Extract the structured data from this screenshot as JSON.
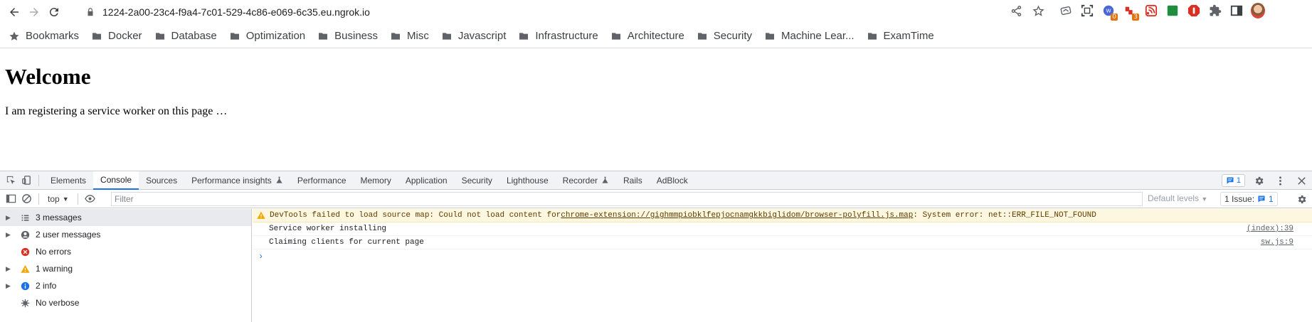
{
  "browser": {
    "url": "1224-2a00-23c4-f9a4-7c01-529-4c86-e069-6c35.eu.ngrok.io",
    "extensions": [
      {
        "icon": "wappalyzer-icon",
        "badge": "0"
      },
      {
        "icon": "ublock-icon",
        "badge": "3"
      }
    ]
  },
  "bookmarks": {
    "root_label": "Bookmarks",
    "folders": [
      "Docker",
      "Database",
      "Optimization",
      "Business",
      "Misc",
      "Javascript",
      "Infrastructure",
      "Architecture",
      "Security",
      "Machine Lear...",
      "ExamTime"
    ]
  },
  "page": {
    "heading": "Welcome",
    "paragraph": "I am registering a service worker on this page …"
  },
  "devtools": {
    "tabs": [
      "Elements",
      "Console",
      "Sources",
      "Performance insights",
      "Performance",
      "Memory",
      "Application",
      "Security",
      "Lighthouse",
      "Recorder",
      "Rails",
      "AdBlock"
    ],
    "active_tab": "Console",
    "issue_badge_count": "1",
    "context": "top",
    "filter_placeholder": "Filter",
    "levels_label": "Default levels",
    "issues_label": "1 Issue:",
    "issues_count": "1",
    "sidebar": [
      {
        "label": "3 messages",
        "icon": "list-icon",
        "expandable": true,
        "selected": true
      },
      {
        "label": "2 user messages",
        "icon": "user-icon",
        "expandable": true,
        "selected": false
      },
      {
        "label": "No errors",
        "icon": "error-icon",
        "expandable": false,
        "selected": false
      },
      {
        "label": "1 warning",
        "icon": "warning-icon",
        "expandable": true,
        "selected": false
      },
      {
        "label": "2 info",
        "icon": "info-icon",
        "expandable": true,
        "selected": false
      },
      {
        "label": "No verbose",
        "icon": "verbose-icon",
        "expandable": false,
        "selected": false
      }
    ],
    "messages": {
      "warning_prefix": "DevTools failed to load source map: Could not load content for ",
      "warning_link": "chrome-extension://gighmmpiobklfepjocnamgkkbiglidom/browser-polyfill.js.map",
      "warning_suffix": ": System error: net::ERR_FILE_NOT_FOUND",
      "log1_text": "Service worker installing",
      "log1_source": "(index):39",
      "log2_text": "Claiming clients for current page",
      "log2_source": "sw.js:9"
    }
  }
}
